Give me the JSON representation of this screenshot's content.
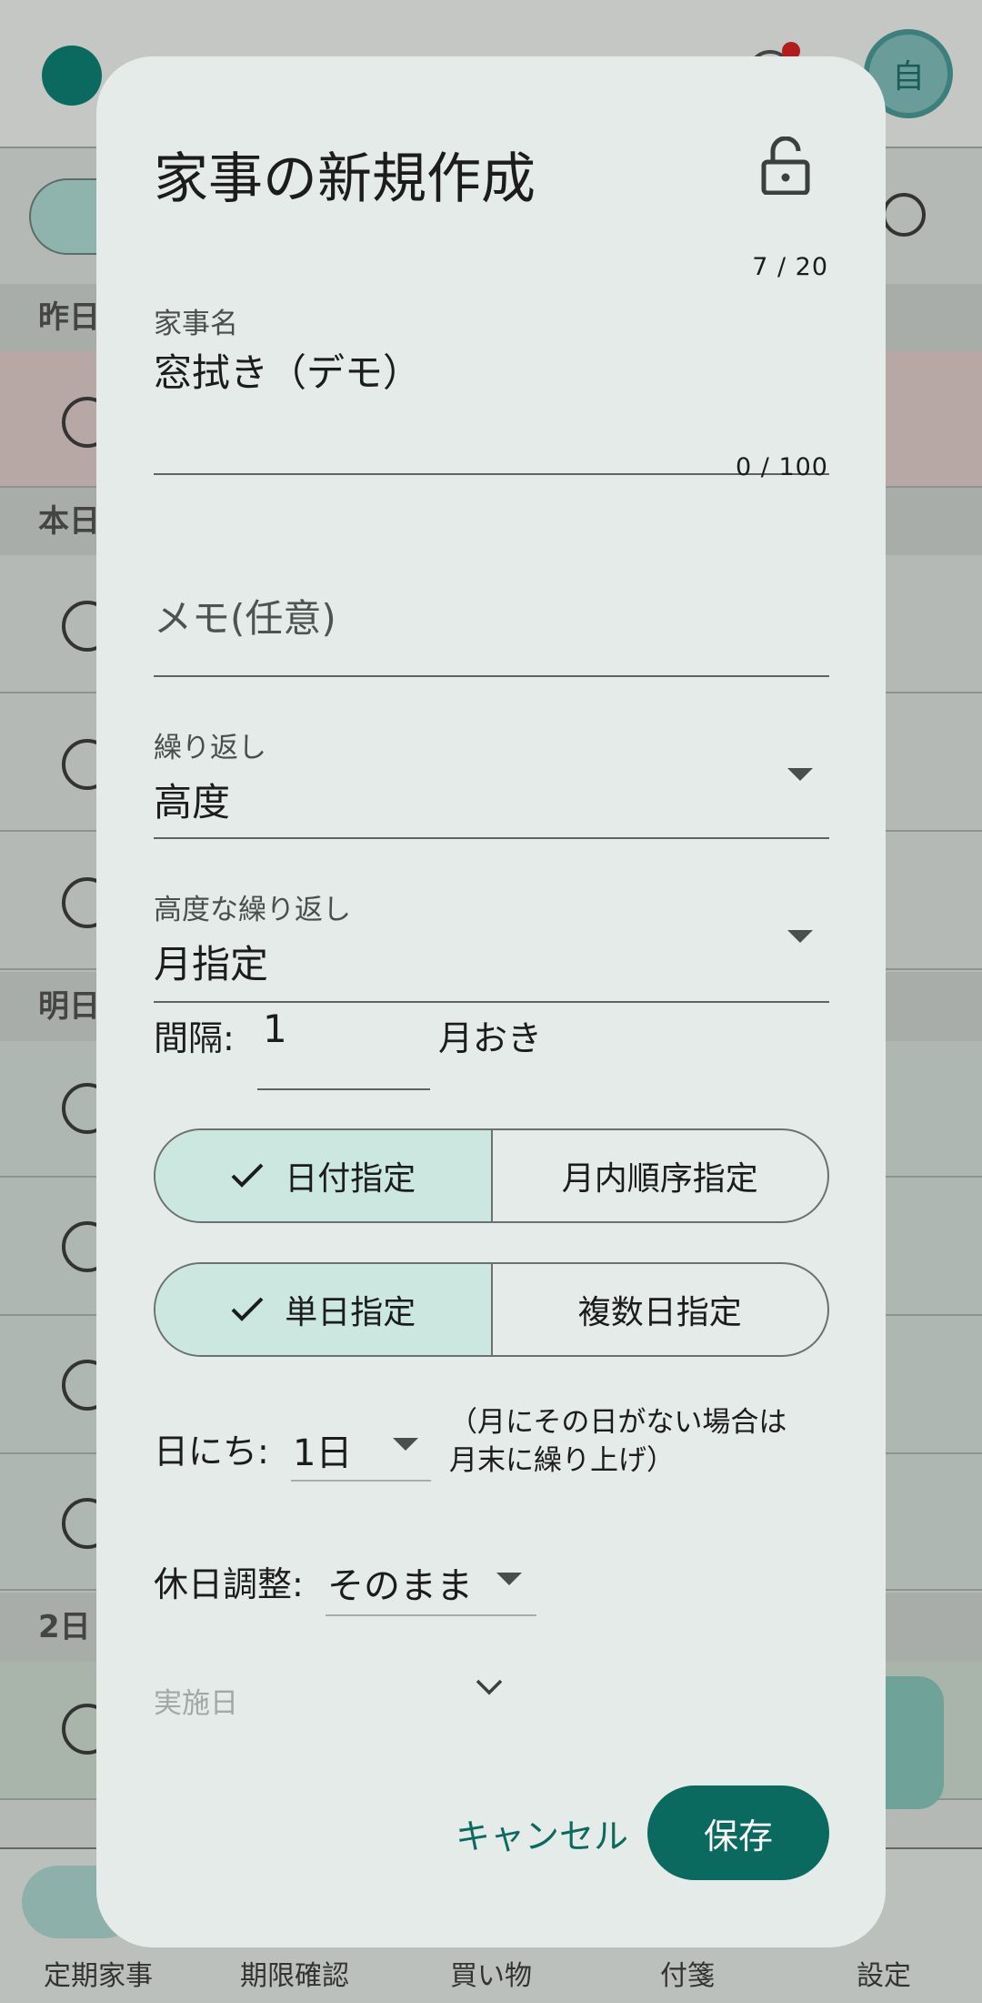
{
  "background": {
    "avatar_letter": "自",
    "bottom_nav": [
      "定期家事",
      "期限確認",
      "買い物",
      "付箋",
      "設定"
    ],
    "section_headers": [
      "昨日",
      "本日",
      "明日",
      "2日"
    ]
  },
  "dialog": {
    "title": "家事の新規作成",
    "name_field": {
      "counter": "7 / 20",
      "label": "家事名",
      "value": "窓拭き（デモ）"
    },
    "memo_field": {
      "counter": "0 / 100",
      "placeholder": "メモ(任意)"
    },
    "repeat_select": {
      "label": "繰り返し",
      "value": "高度"
    },
    "advanced_repeat_select": {
      "label": "高度な繰り返し",
      "value": "月指定"
    },
    "interval": {
      "label": "間隔:",
      "value": "1",
      "unit": "月おき"
    },
    "segment_mode": {
      "options": [
        "日付指定",
        "月内順序指定"
      ],
      "selected": "日付指定"
    },
    "segment_day_type": {
      "options": [
        "単日指定",
        "複数日指定"
      ],
      "selected": "単日指定"
    },
    "day_select": {
      "label": "日にち:",
      "value": "1日",
      "note": "（月にその日がない場合は\n月末に繰り上げ）"
    },
    "holiday_adjust": {
      "label": "休日調整:",
      "value": "そのまま"
    },
    "execution_day": {
      "label": "実施日"
    },
    "buttons": {
      "cancel": "キャンセル",
      "save": "保存"
    }
  }
}
